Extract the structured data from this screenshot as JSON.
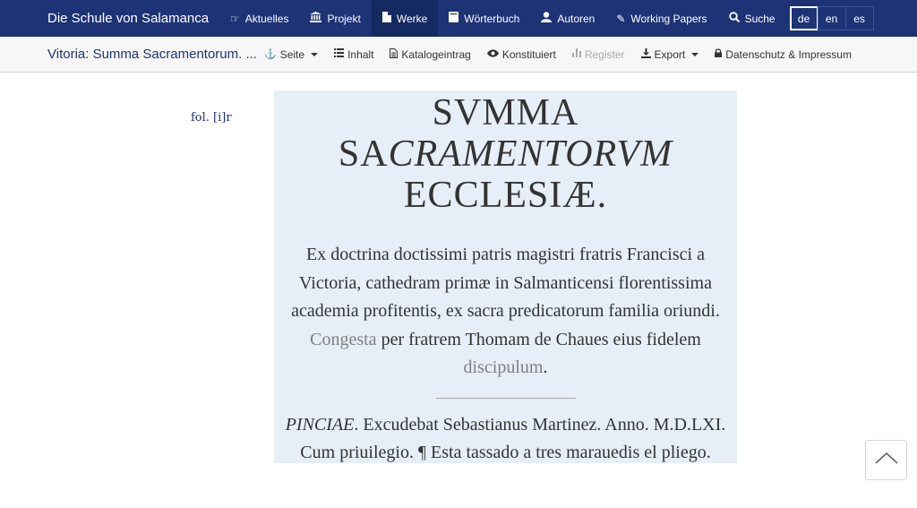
{
  "brand": "Die Schule von Salamanca",
  "nav": [
    {
      "label": "Aktuelles",
      "icon": "hand-point-icon",
      "glyph": "☞"
    },
    {
      "label": "Projekt",
      "icon": "institution-icon",
      "glyph": "🏛"
    },
    {
      "label": "Werke",
      "icon": "file-icon",
      "glyph": "▆",
      "active": true
    },
    {
      "label": "Wörterbuch",
      "icon": "book-icon",
      "glyph": "▉"
    },
    {
      "label": "Autoren",
      "icon": "user-icon",
      "glyph": "●"
    },
    {
      "label": "Working Papers",
      "icon": "pencil-icon",
      "glyph": "✎"
    },
    {
      "label": "Suche",
      "icon": "search-icon",
      "glyph": "⚲"
    }
  ],
  "languages": [
    "de",
    "en",
    "es"
  ],
  "active_language": "de",
  "toolbar": {
    "doc_title": "Vitoria: Summa Sacramentorum. ...",
    "seite": "Seite",
    "inhalt": "Inhalt",
    "katalog": "Katalogeintrag",
    "konstituiert": "Konstituiert",
    "register": "Register",
    "export": "Export",
    "datenschutz": "Datenschutz & Impressum"
  },
  "folio": "fol. [i]r",
  "titlepage": {
    "title_1": "SVMMA",
    "title_2a": "SA",
    "title_2b": "CRAMENTORVM",
    "title_3": "ECCLESIÆ.",
    "imprint_1": "Ex doctrina doctissimi patris magistri fratris Francisci a Victoria, cathedram primæ in Salmanticensi florentissima academia profitentis, ex sacra predicatorum familia oriundi. ",
    "imprint_congesta": "Congesta",
    "imprint_2": " per fratrem Thomam de Chaues eius fidelem ",
    "imprint_discipulum": "discipulum",
    "imprint_3": ".",
    "pub_place": "PINCIAE",
    "pub_rest": ". Excudebat Sebastianus Martinez. Anno. M.D.LXI. Cum priuilegio. ¶ Esta tassado a tres marauedis el pliego."
  },
  "colors": {
    "navbar": "#1d3375",
    "titlepage_bg": "#e6eef8",
    "link_gray": "#808080"
  }
}
